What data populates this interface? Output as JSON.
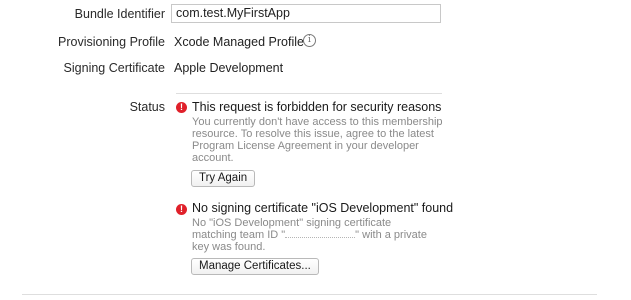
{
  "signing": {
    "bundle_identifier_label": "Bundle Identifier",
    "bundle_identifier_value": "com.test.MyFirstApp",
    "provisioning_profile_label": "Provisioning Profile",
    "provisioning_profile_value": "Xcode Managed Profile",
    "signing_certificate_label": "Signing Certificate",
    "signing_certificate_value": "Apple Development",
    "status_label": "Status"
  },
  "icons": {
    "info": "info-circle-icon",
    "error": "error-exclamation-icon"
  },
  "colors": {
    "error_red": "#e0202a",
    "secondary_text": "#8a8a8a"
  },
  "errors": [
    {
      "title": "This request is forbidden for security reasons",
      "description": "You currently don't have access to this membership resource. To resolve this issue, agree to the latest Program License Agreement in your developer account.",
      "button_label": "Try Again"
    },
    {
      "title": "No signing certificate \"iOS Development\" found",
      "description_part1": "No \"iOS Development\" signing certificate matching team ID \"",
      "description_part2": "\" with a private key was found.",
      "button_label": "Manage Certificates..."
    }
  ]
}
